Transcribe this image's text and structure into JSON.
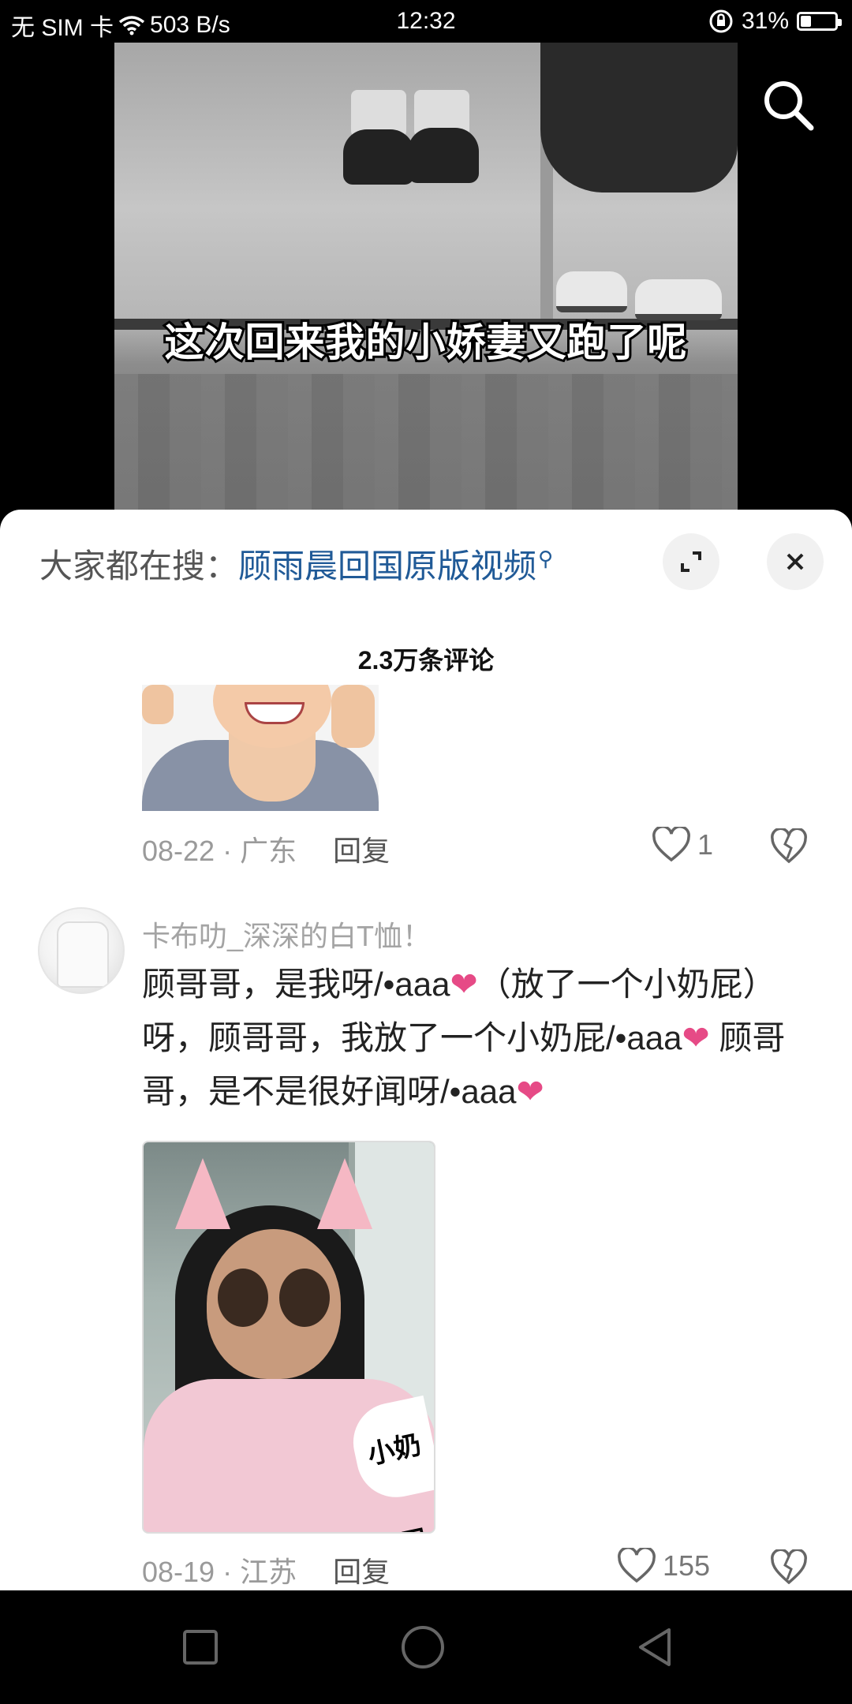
{
  "status_bar": {
    "carrier": "无 SIM 卡",
    "net_speed": "503 B/s",
    "time": "12:32",
    "battery_percent": "31%",
    "battery_level": 0.31
  },
  "video": {
    "subtitle": "这次回来我的小娇妻又跑了呢"
  },
  "sheet": {
    "search_prefix": "大家都在搜：",
    "search_term": "顾雨晨回国原版视频",
    "comment_count": "2.3万条评论"
  },
  "comments": [
    {
      "date_location": "08-22 · 广东",
      "reply_label": "回复",
      "likes": "1"
    },
    {
      "username": "卡布叻_深深的白T恤！",
      "text_parts": [
        "顾哥哥，是我呀/•aaa",
        "❤",
        "（放了一个小奶屁）呀，顾哥哥，我放了一个小奶屁/•aaa",
        "❤",
        "  顾哥哥，是不是很好闻呀/•aaa",
        "❤"
      ],
      "image_sticker_text": "小奶屁",
      "date_location": "08-19 · 江苏",
      "reply_label": "回复",
      "likes": "155"
    }
  ],
  "icons": {
    "search": "search-icon",
    "expand": "expand-icon",
    "close": "close-icon",
    "like": "heart-outline-icon",
    "dislike": "broken-heart-icon",
    "nav_recent": "square-icon",
    "nav_home": "circle-icon",
    "nav_back": "triangle-back-icon"
  }
}
